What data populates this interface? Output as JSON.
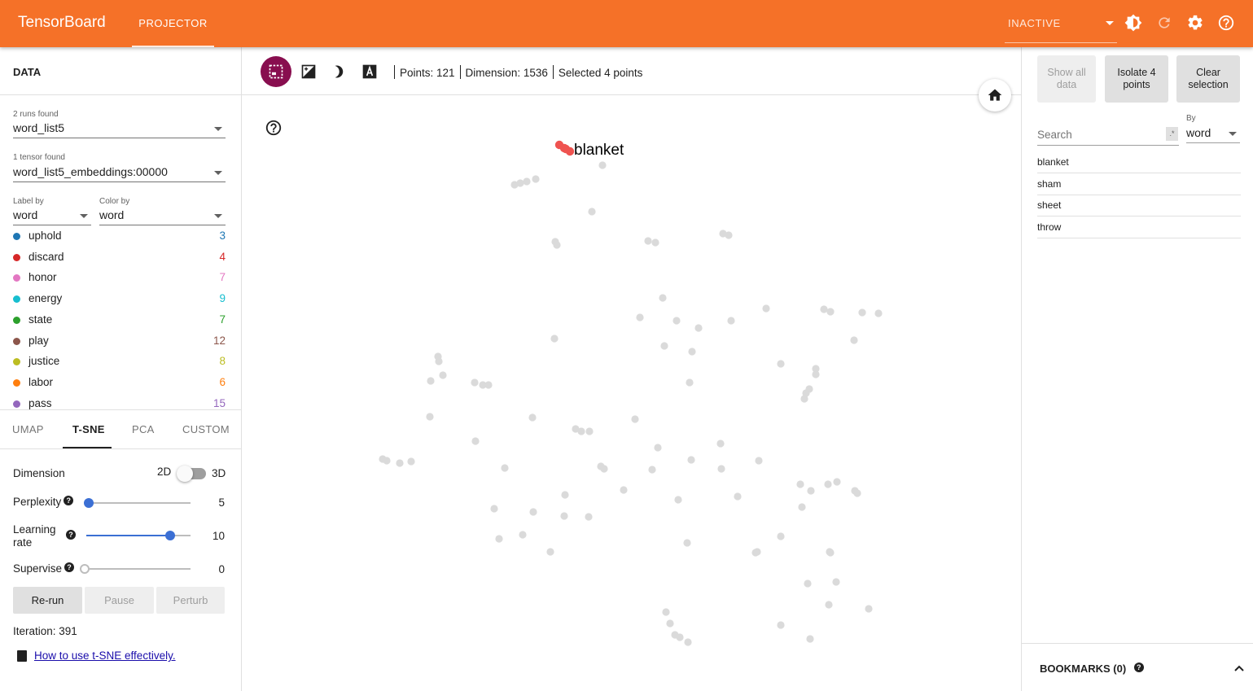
{
  "header": {
    "brand": "TensorBoard",
    "tab": "PROJECTOR",
    "run_status": "INACTIVE",
    "icons": [
      "dropdown-caret-icon",
      "brightness-icon",
      "refresh-icon",
      "settings-icon",
      "help-icon"
    ]
  },
  "left_panel": {
    "title": "DATA",
    "runs_label": "2 runs found",
    "run_value": "word_list5",
    "tensor_label": "1 tensor found",
    "tensor_value": "word_list5_embeddings:00000",
    "label_by_label": "Label by",
    "label_by_value": "word",
    "color_by_label": "Color by",
    "color_by_value": "word",
    "legend": [
      {
        "name": "uphold",
        "count": "3",
        "color": "#1f77b4"
      },
      {
        "name": "discard",
        "count": "4",
        "color": "#d62728"
      },
      {
        "name": "honor",
        "count": "7",
        "color": "#e377c2"
      },
      {
        "name": "energy",
        "count": "9",
        "color": "#17becf"
      },
      {
        "name": "state",
        "count": "7",
        "color": "#2ca02c"
      },
      {
        "name": "play",
        "count": "12",
        "color": "#8c564b"
      },
      {
        "name": "justice",
        "count": "8",
        "color": "#bcbd22"
      },
      {
        "name": "labor",
        "count": "6",
        "color": "#ff7f0e"
      },
      {
        "name": "pass",
        "count": "15",
        "color": "#9467bd"
      }
    ],
    "projection_tabs": [
      "UMAP",
      "T-SNE",
      "PCA",
      "CUSTOM"
    ],
    "active_tab": "T-SNE",
    "dimension_label": "Dimension",
    "dim_2d": "2D",
    "dim_3d": "3D",
    "perplexity_label": "Perplexity",
    "perplexity_value": "5",
    "learning_rate_label": "Learning rate",
    "learning_rate_value": "10",
    "supervise_label": "Supervise",
    "supervise_value": "0",
    "rerun_label": "Re-run",
    "pause_label": "Pause",
    "perturb_label": "Perturb",
    "iteration_text": "Iteration: 391",
    "help_link": "How to use t-SNE effectively."
  },
  "main": {
    "points_text": "Points: 121",
    "dimension_text": "Dimension: 1536",
    "selected_text": "Selected 4 points",
    "plot_label": "blanket",
    "selected_color": "#ef5350",
    "point_color": "#dadada",
    "selection_color": "#880e4f"
  },
  "right_panel": {
    "show_all_label": "Show all data",
    "isolate_label": "Isolate 4 points",
    "clear_label": "Clear selection",
    "search_placeholder": "Search",
    "regex_label": ".*",
    "by_label": "By",
    "by_value": "word",
    "results": [
      "blanket",
      "sham",
      "sheet",
      "throw"
    ],
    "bookmarks_label": "BOOKMARKS (0)"
  }
}
